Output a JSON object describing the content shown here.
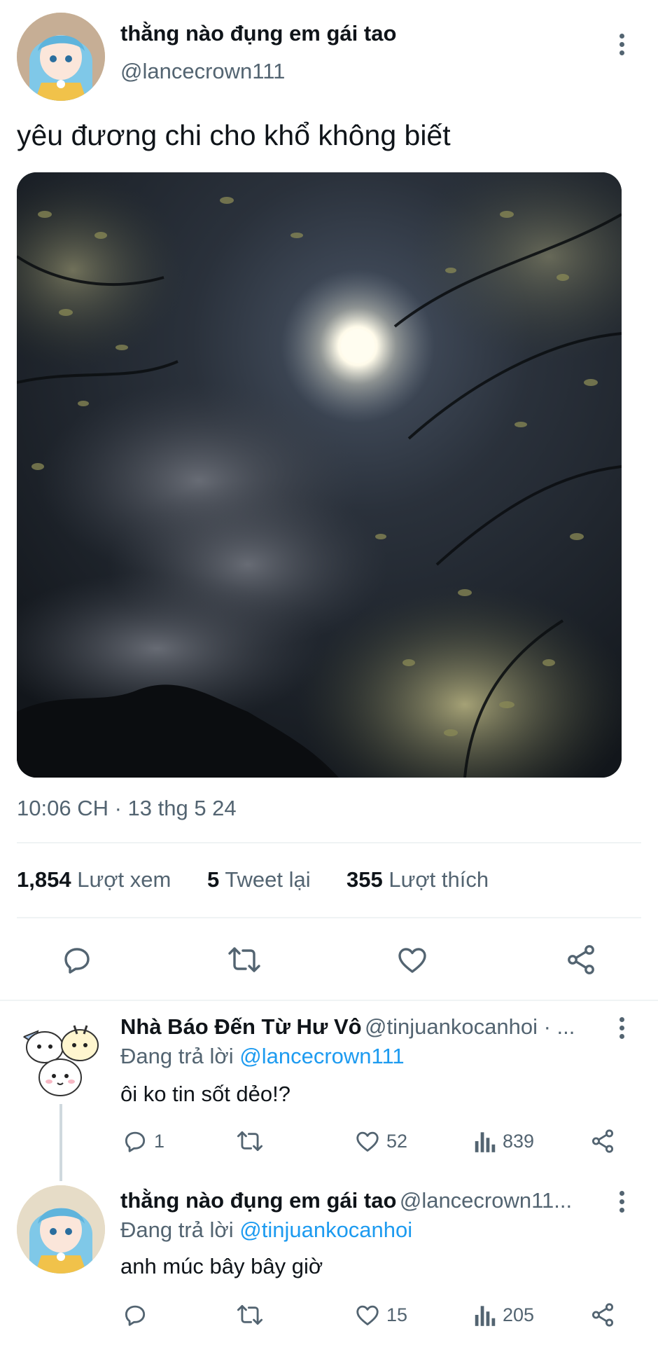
{
  "tweet": {
    "display_name": "thằng nào đụng em gái tao",
    "handle": "@lancecrown111",
    "text": "yêu đương chi cho khổ không biết",
    "timestamp": "10:06 CH · 13 thg 5 24",
    "stats": {
      "views_count": "1,854",
      "views_label": "Lượt xem",
      "retweets_count": "5",
      "retweets_label": "Tweet lại",
      "likes_count": "355",
      "likes_label": "Lượt thích"
    }
  },
  "replies": [
    {
      "display_name": "Nhà Báo Đến Từ Hư Vô",
      "handle": "@tinjuankocanhoi · ...",
      "replying_prefix": "Đang trả lời",
      "replying_to": "@lancecrown111",
      "text": "ôi ko tin sốt dẻo!?",
      "reply_count": "1",
      "like_count": "52",
      "view_count": "839"
    },
    {
      "display_name": "thằng nào đụng em gái tao",
      "handle": "@lancecrown11...",
      "replying_prefix": "Đang trả lời",
      "replying_to": "@tinjuankocanhoi",
      "text": "anh múc bây bây giờ",
      "reply_count": "",
      "like_count": "15",
      "view_count": "205"
    }
  ],
  "icons": [
    "kebab-menu-icon",
    "reply-icon",
    "retweet-icon",
    "like-icon",
    "share-icon",
    "views-icon"
  ],
  "colors": {
    "link": "#1d9bf0",
    "secondary": "#536471",
    "primary": "#0f1419"
  }
}
